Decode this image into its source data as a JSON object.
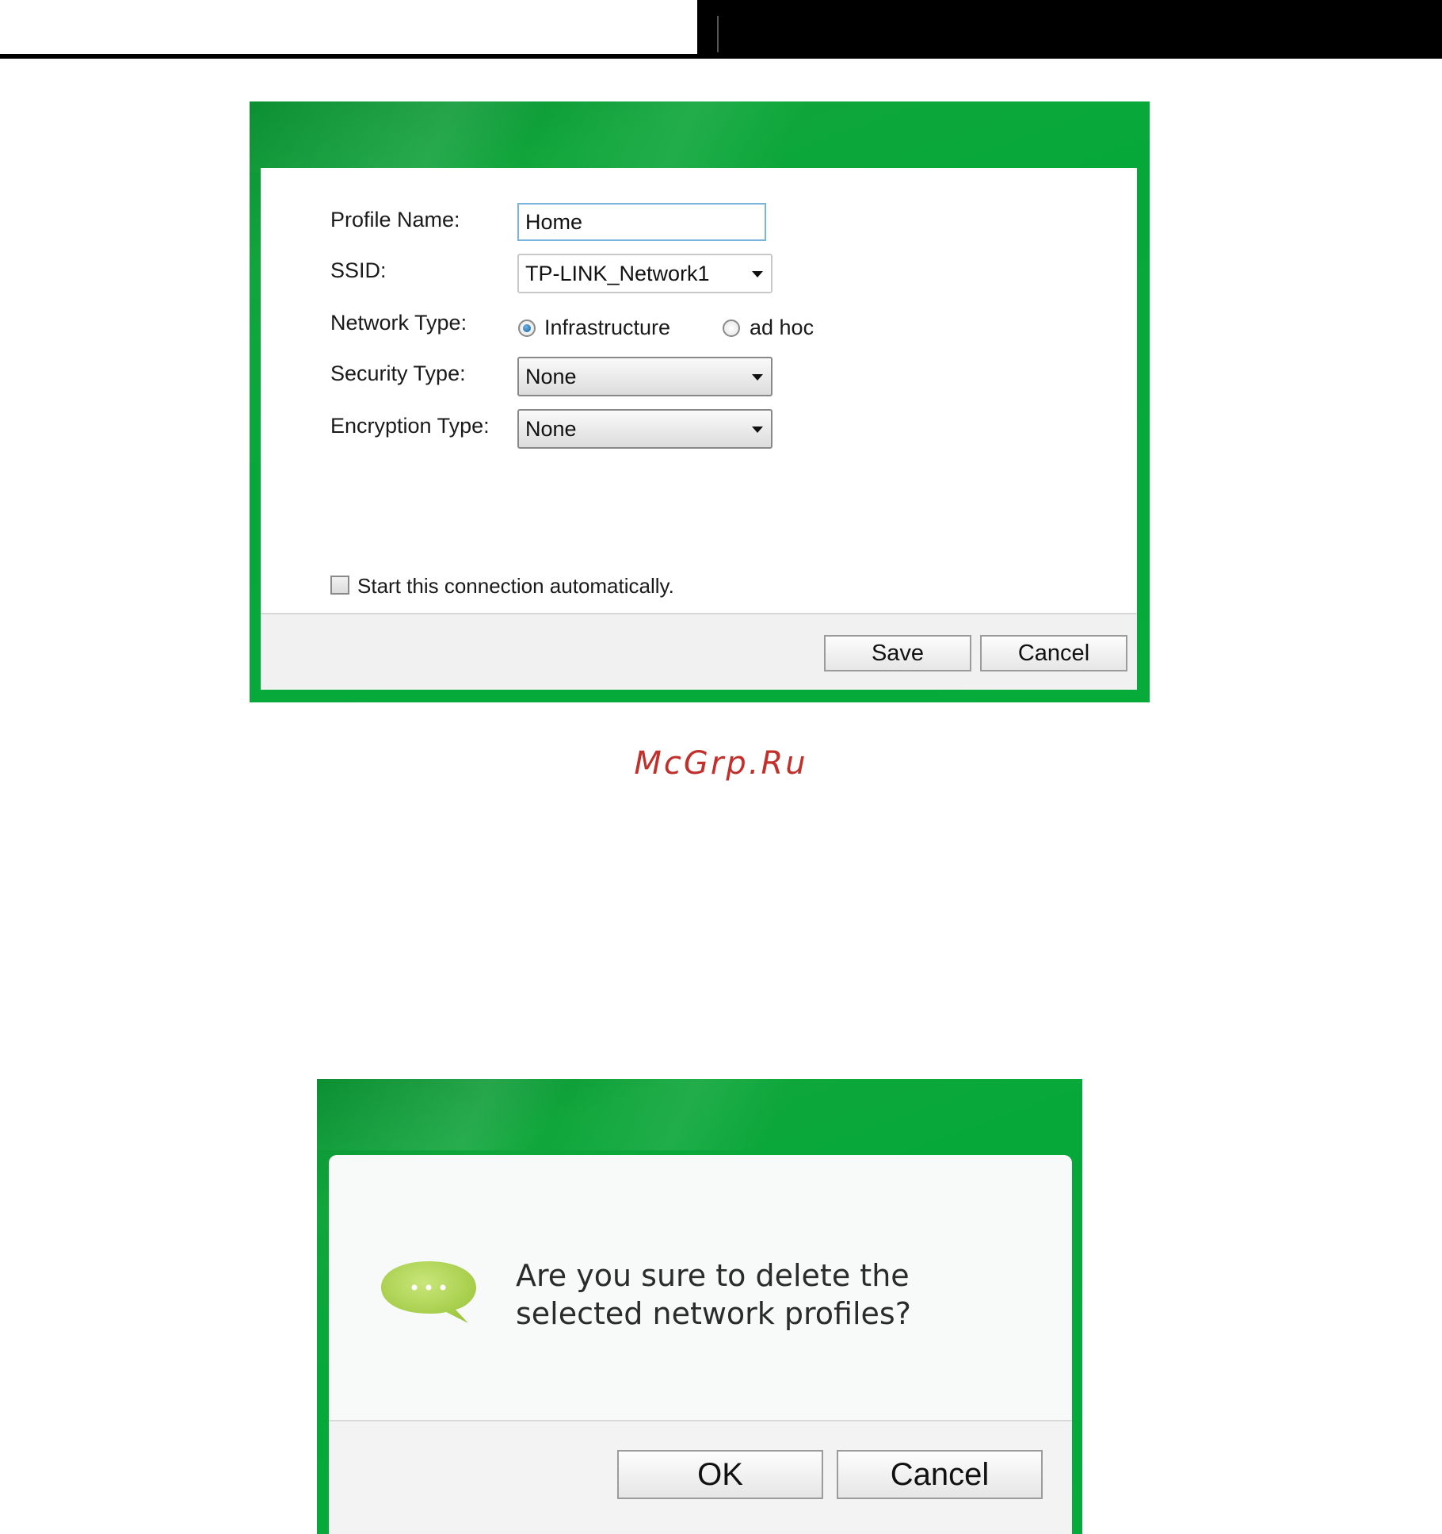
{
  "profile_dialog": {
    "profile_name_label": "Profile Name:",
    "profile_name_value": "Home",
    "ssid_label": "SSID:",
    "ssid_value": "TP-LINK_Network1",
    "network_type_label": "Network Type:",
    "network_type_options": [
      "Infrastructure",
      "ad hoc"
    ],
    "network_type_selected": "Infrastructure",
    "security_type_label": "Security Type:",
    "security_type_value": "None",
    "encryption_type_label": "Encryption Type:",
    "encryption_type_value": "None",
    "auto_connect_label": "Start this connection automatically.",
    "auto_connect_checked": false,
    "save_label": "Save",
    "cancel_label": "Cancel"
  },
  "watermark": "McGrp.Ru",
  "confirm_dialog": {
    "message": "Are you sure to delete the selected network profiles?",
    "ok_label": "OK",
    "cancel_label": "Cancel",
    "icon": "speech-bubble-icon"
  },
  "colors": {
    "frame_green": "#06ab3a",
    "bubble_green": "#a9d34a",
    "watermark_red": "#c2302c"
  }
}
